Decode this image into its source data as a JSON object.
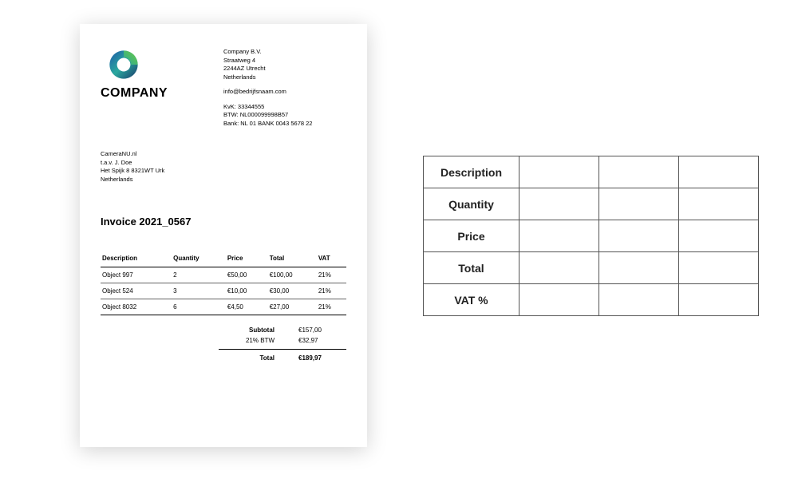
{
  "logo": {
    "text": "COMPANY"
  },
  "company": {
    "name": "Company B.V.",
    "street": "Straatweg 4",
    "postcode": "2244AZ Utrecht",
    "country": "Netherlands",
    "email": "info@bedrijfsnaam.com",
    "kvk": "KvK: 33344555",
    "btw": "BTW: NL000099998B57",
    "bank": "Bank: NL 01 BANK 0043 5678 22"
  },
  "addressee": {
    "name": "CameraNU.nl",
    "attn": "t.a.v. J. Doe",
    "street": "Het Spijk 8 8321WT Urk",
    "country": "Netherlands"
  },
  "invoice": {
    "title": "Invoice 2021_0567"
  },
  "table": {
    "headers": {
      "desc": "Description",
      "qty": "Quantity",
      "price": "Price",
      "total": "Total",
      "vat": "VAT"
    },
    "rows": [
      {
        "desc": "Object 997",
        "qty": "2",
        "price": "€50,00",
        "total": "€100,00",
        "vat": "21%"
      },
      {
        "desc": "Object 524",
        "qty": "3",
        "price": "€10,00",
        "total": "€30,00",
        "vat": "21%"
      },
      {
        "desc": "Object 8032",
        "qty": "6",
        "price": "€4,50",
        "total": "€27,00",
        "vat": "21%"
      }
    ]
  },
  "totals": {
    "subtotal_label": "Subtotal",
    "subtotal_val": "€157,00",
    "vat_label": "21% BTW",
    "vat_val": "€32,97",
    "total_label": "Total",
    "total_val": "€189,97"
  },
  "sideTable": {
    "rows": [
      "Description",
      "Quantity",
      "Price",
      "Total",
      "VAT %"
    ]
  }
}
